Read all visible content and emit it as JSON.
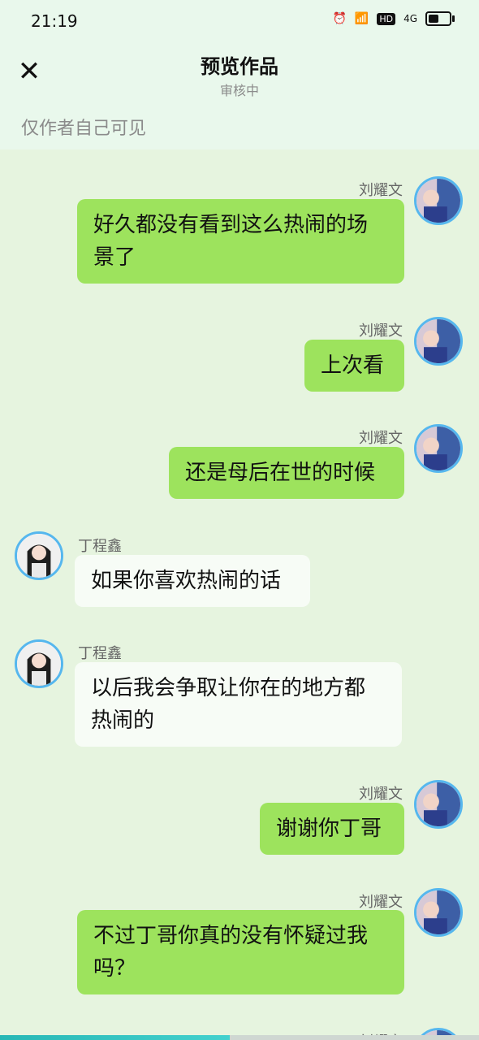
{
  "status_bar": {
    "time": "21:19",
    "icons": [
      "alarm-icon",
      "wifi-icon",
      "hd-icon",
      "4g-signal-icon",
      "battery-icon"
    ],
    "network_label": "4G"
  },
  "header": {
    "title": "预览作品",
    "subtitle": "审核中",
    "close_icon": "close-icon"
  },
  "visibility_note": "仅作者自己可见",
  "messages": [
    {
      "side": "right",
      "sender": "刘耀文",
      "text": "好久都没有看到这么热闹的场景了"
    },
    {
      "side": "right",
      "sender": "刘耀文",
      "text": "上次看"
    },
    {
      "side": "right",
      "sender": "刘耀文",
      "text": "还是母后在世的时候"
    },
    {
      "side": "left",
      "sender": "丁程鑫",
      "text": "如果你喜欢热闹的话"
    },
    {
      "side": "left",
      "sender": "丁程鑫",
      "text": "以后我会争取让你在的地方都热闹的"
    },
    {
      "side": "right",
      "sender": "刘耀文",
      "text": "谢谢你丁哥"
    },
    {
      "side": "right",
      "sender": "刘耀文",
      "text": "不过丁哥你真的没有怀疑过我吗？"
    },
    {
      "side": "right",
      "sender": "刘耀文",
      "text": ""
    }
  ],
  "colors": {
    "background": "#e6f4df",
    "bubble_right": "#9de35d",
    "bubble_left": "#f7fcf6",
    "avatar_ring": "#56b7ee",
    "progress": "#3ec7c4"
  },
  "progress": {
    "value": 0.48
  }
}
